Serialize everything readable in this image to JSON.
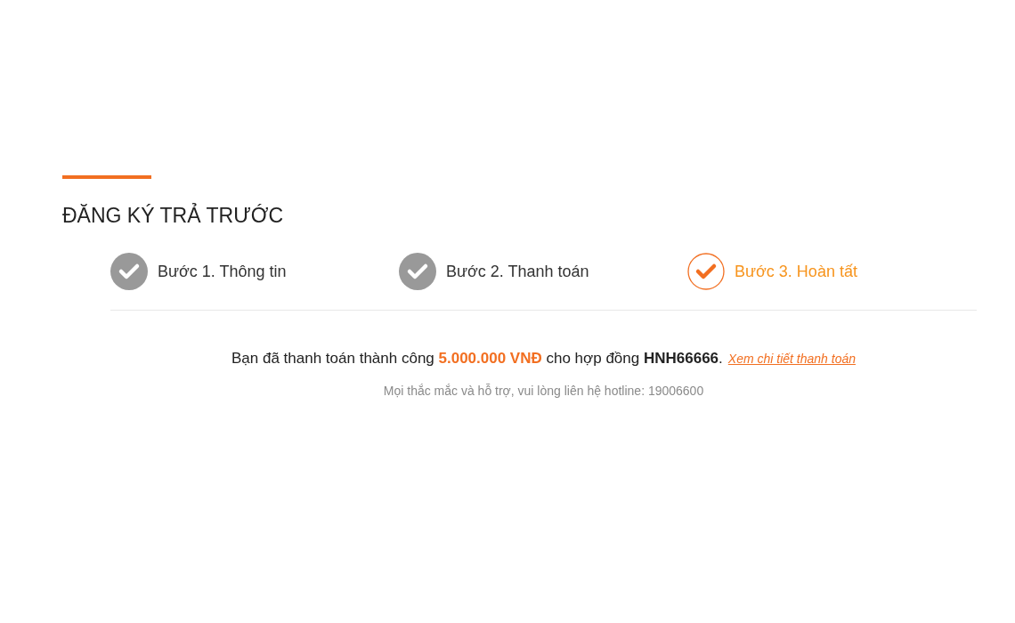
{
  "title": "ĐĂNG KÝ TRẢ TRƯỚC",
  "steps": [
    {
      "label": "Bước 1. Thông tin",
      "selected": false
    },
    {
      "label": "Bước 2. Thanh toán",
      "selected": false
    },
    {
      "label": "Bước 3. Hoàn tất",
      "selected": true
    }
  ],
  "message": [
    {
      "kind": "plain",
      "text": "Bạn đã thanh toán thành công "
    },
    {
      "kind": "amount",
      "text": "5.000.000 VNĐ"
    },
    {
      "kind": "plain",
      "text": " cho hợp đồng "
    },
    {
      "kind": "contract",
      "text": "HNH66666"
    },
    {
      "kind": "plain",
      "text": "."
    }
  ],
  "details_link": "Xem chi tiết thanh toán",
  "hint": "Mọi thắc mắc và hỗ trợ, vui lòng liên hệ hotline: 19006600"
}
